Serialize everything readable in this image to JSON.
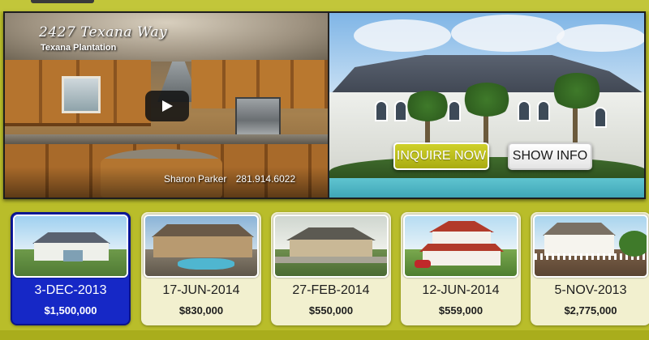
{
  "video": {
    "title": "2427 Texana Way",
    "subtitle": "Texana Plantation",
    "agent_name": "Sharon Parker",
    "agent_phone": "281.914.6022",
    "play_icon": "play-icon"
  },
  "actions": {
    "inquire_label": "INQUIRE NOW",
    "show_info_label": "SHOW INFO"
  },
  "colors": {
    "background": "#b9bd2a",
    "active_card": "#1628c6",
    "card": "#f2f0cf",
    "inquire_button": "#bfc11e"
  },
  "listings": [
    {
      "date": "3-DEC-2013",
      "price": "$1,500,000",
      "active": true
    },
    {
      "date": "17-JUN-2014",
      "price": "$830,000",
      "active": false
    },
    {
      "date": "27-FEB-2014",
      "price": "$550,000",
      "active": false
    },
    {
      "date": "12-JUN-2014",
      "price": "$559,000",
      "active": false
    },
    {
      "date": "5-NOV-2013",
      "price": "$2,775,000",
      "active": false
    }
  ]
}
